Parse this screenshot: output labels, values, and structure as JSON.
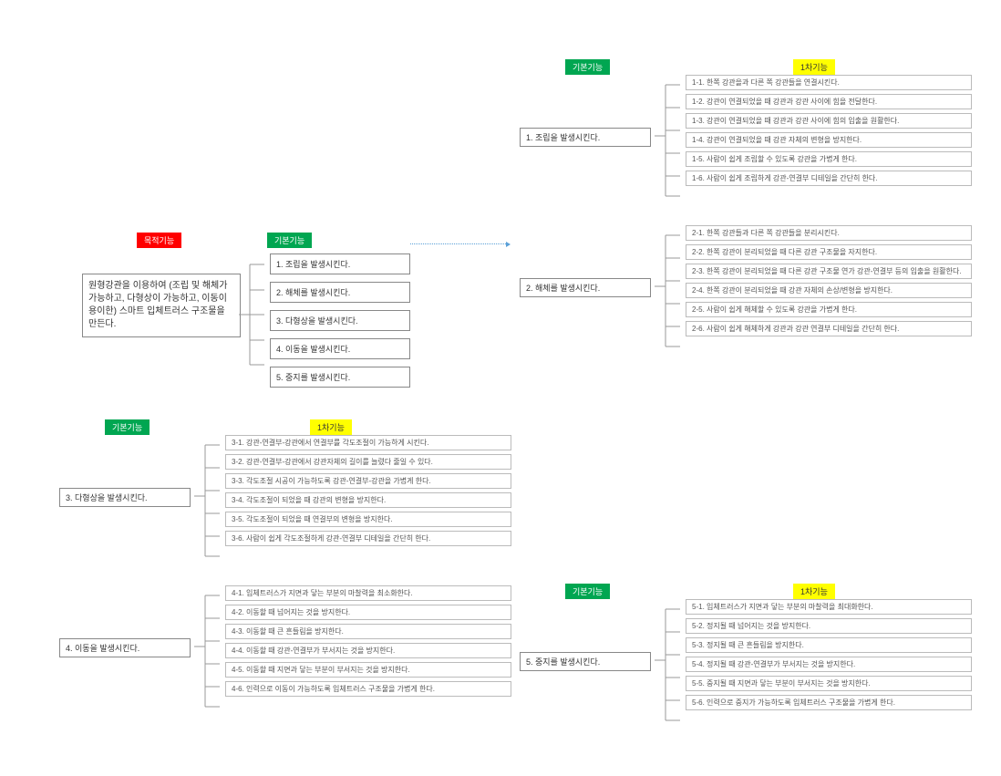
{
  "tags": {
    "core": "목적기능",
    "basic": "기본기능",
    "primary": "1차기능"
  },
  "core": "원형강관을 이용하여 (조립 및 해체가 가능하고, 다형상이 가능하고, 이동이 용이한) 스마트 입체트러스 구조물을 만든다.",
  "basic": [
    "1. 조립을 발생시킨다.",
    "2. 해체를 발생시킨다.",
    "3. 다형상을 발생시킨다.",
    "4. 이동을 발생시킨다.",
    "5. 중지를 발생시킨다."
  ],
  "groups": {
    "g1": {
      "head": "1. 조립을 발생시킨다.",
      "items": [
        "1-1. 한쪽 강관을과 다른 쪽 강관들을 연결시킨다.",
        "1-2. 강관이 연결되었을 때 강관과 강관 사이에 힘을 전달한다.",
        "1-3. 강관이 연결되었을 때 강관과 강관 사이에 힘의 입출을 원활한다.",
        "1-4. 강관이 연결되었을 때 강관 자체의 변형을 방지한다.",
        "1-5. 사람이 쉽게 조립할 수 있도록 강관을 가볍게 한다.",
        "1-6. 사람이 쉽게 조립하게 강관-연결부 디테일을 간단히 한다."
      ]
    },
    "g2": {
      "head": "2. 해체를 발생시킨다.",
      "items": [
        "2-1. 한쪽 강관들과 다른 쪽 강관들을 분리시킨다.",
        "2-2. 한쪽 강관이 분리되었을 때 다른 강관 구조물을 자지한다.",
        "2-3. 한쪽 강관이 분리되었을 때 다른 강관 구조물 연가 강관-연결부 등의 입출을 원활한다.",
        "2-4. 한쪽 강관이 분리되었을 때 강관 자체의 손상/변형을 방지한다.",
        "2-5. 사람이 쉽게 해체할 수 있도록 강관을 가볍게 한다.",
        "2-6. 사람이 쉽게 해체하게 강관과 강관 연결부 디테일을 간단히 한다."
      ]
    },
    "g3": {
      "head": "3. 다형상을 발생시킨다.",
      "items": [
        "3-1. 강관-연결부-강관에서 연결부를 각도조절이 가능하게 시킨다.",
        "3-2. 강관-연결부-강관에서 강관자체의 길이를 늘렸다 줄일 수 있다.",
        "3-3. 각도조절 시공이 가능하도록 강관-연결부-강관을 가볍게 한다.",
        "3-4. 각도조절이 되었을 때 강관의 변형을 방지한다.",
        "3-5. 각도조절이 되었을 때 연결부의 변형을 방지한다.",
        "3-6. 사람이 쉽게 각도조절하게 강관-연결부 디테일을 간단히 한다."
      ]
    },
    "g4": {
      "head": "4. 이동을 발생시킨다.",
      "items": [
        "4-1. 입체트러스가 지면과 닿는 부분의 마찰력을 최소화한다.",
        "4-2. 이동할 때 넘어지는 것을 방지한다.",
        "4-3. 이동할 때 큰 흔들림을 방지한다.",
        "4-4. 이동할 때 강관-연결부가 부서지는 것을 방지한다.",
        "4-5. 이동할 때 지면과 닿는 부분이 부서지는 것을 방지한다.",
        "4-6. 인력으로 이동이 가능하도록 입체트러스 구조물을 가볍게 한다."
      ]
    },
    "g5": {
      "head": "5. 중지를 발생시킨다.",
      "items": [
        "5-1. 입체트러스가 지면과 닿는 부분의 마찰력을 최대화한다.",
        "5-2. 정지될 때 넘어지는 것을 방지한다.",
        "5-3. 정지될 때 큰 흔들림을 방지한다.",
        "5-4. 정지될 때 강관-연결부가 부서지는 것을 방지한다.",
        "5-5. 중지될 때 지면과 닿는 부분이 부서지는 것을 방지한다.",
        "5-6. 인력으로 중지가 가능하도록 입체트러스 구조물을 가볍게 한다."
      ]
    }
  }
}
